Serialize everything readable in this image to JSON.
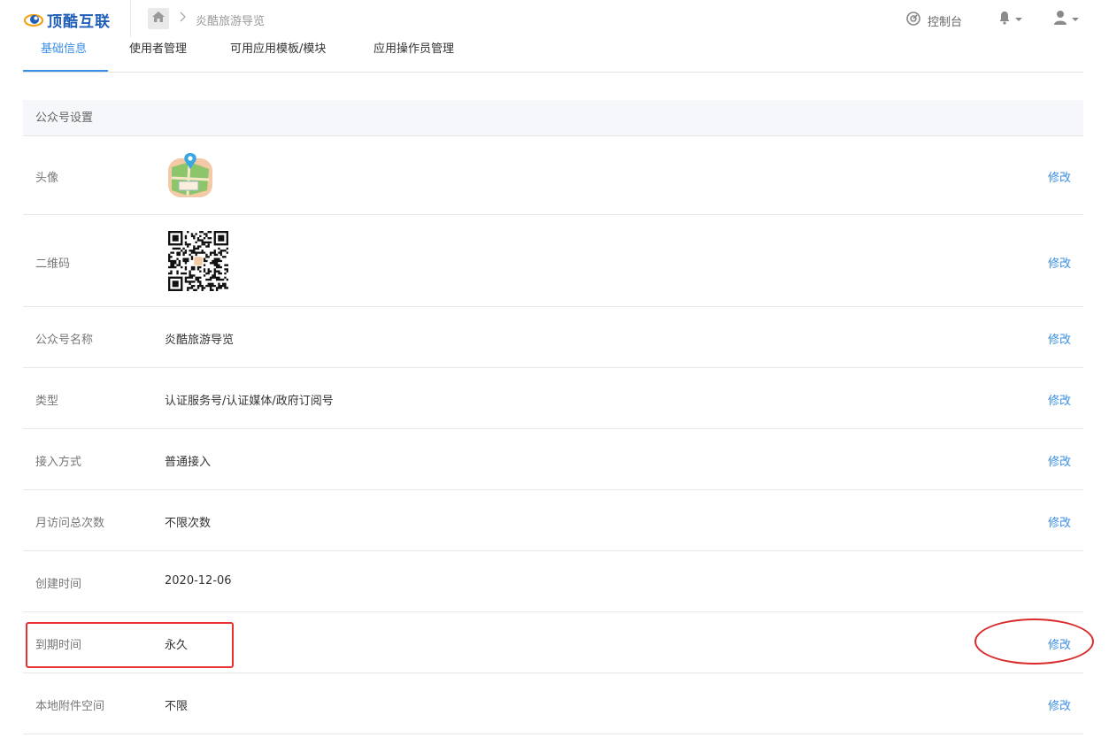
{
  "header": {
    "brand": "顶酷互联",
    "breadcrumb": "炎酷旅游导览",
    "console_label": "控制台",
    "icons": [
      "logo-icon",
      "home-icon",
      "chevron-right-icon",
      "dashboard-icon",
      "bell-icon",
      "user-icon"
    ]
  },
  "tabs": [
    {
      "label": "基础信息",
      "active": true
    },
    {
      "label": "使用者管理",
      "active": false
    },
    {
      "label": "可用应用模板/模块",
      "active": false
    },
    {
      "label": "应用操作员管理",
      "active": false
    }
  ],
  "panel": {
    "title": "公众号设置",
    "rows": [
      {
        "label": "头像",
        "value": "",
        "edit": "修改",
        "kind": "avatar"
      },
      {
        "label": "二维码",
        "value": "",
        "edit": "修改",
        "kind": "qrcode"
      },
      {
        "label": "公众号名称",
        "value": "炎酷旅游导览",
        "edit": "修改"
      },
      {
        "label": "类型",
        "value": "认证服务号/认证媒体/政府订阅号",
        "edit": "修改"
      },
      {
        "label": "接入方式",
        "value": "普通接入",
        "edit": "修改"
      },
      {
        "label": "月访问总次数",
        "value": "不限次数",
        "edit": "修改"
      },
      {
        "label": "创建时间",
        "value": "2020-12-06",
        "edit": ""
      },
      {
        "label": "到期时间",
        "value": "永久",
        "edit": "修改"
      },
      {
        "label": "本地附件空间",
        "value": "不限",
        "edit": "修改"
      }
    ]
  },
  "colors": {
    "accent": "#3a8ee6",
    "annotation": "#e8322f"
  }
}
